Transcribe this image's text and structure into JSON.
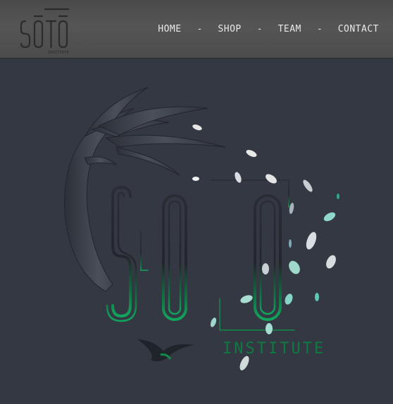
{
  "header": {
    "logo": {
      "text": "SŌTŌ",
      "subtext": "INSTITUTE"
    },
    "nav": [
      {
        "label": "HOME"
      },
      {
        "label": "SHOP"
      },
      {
        "label": "TEAM"
      },
      {
        "label": "CONTACT"
      }
    ],
    "nav_separator": "-"
  },
  "hero": {
    "logo_text": "SŌTŌ",
    "logo_subtext": "INSTITUTE"
  },
  "colors": {
    "background": "#343842",
    "header": "#515152",
    "accent_green": "#0e8a4a",
    "accent_teal": "#7fd6c8"
  }
}
